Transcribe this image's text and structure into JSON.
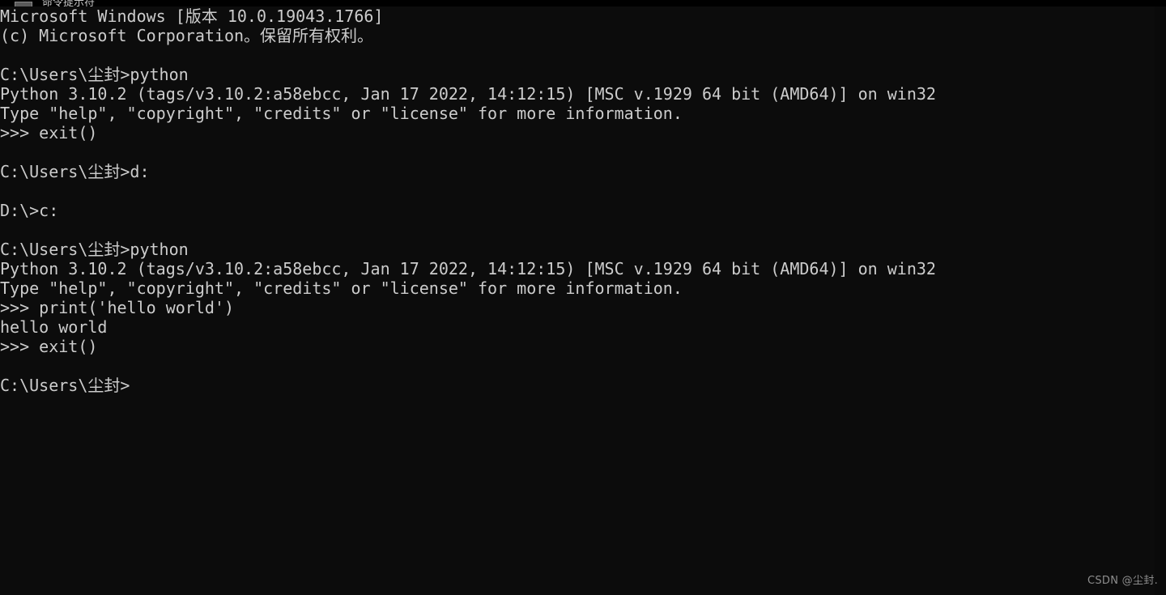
{
  "window": {
    "title": "命令提示符",
    "icon": "console-icon",
    "background_color": "#0c0c0c",
    "foreground_color": "#cccccc"
  },
  "terminal": {
    "lines": [
      "Microsoft Windows [版本 10.0.19043.1766]",
      "(c) Microsoft Corporation。保留所有权利。",
      "",
      "C:\\Users\\尘封>python",
      "Python 3.10.2 (tags/v3.10.2:a58ebcc, Jan 17 2022, 14:12:15) [MSC v.1929 64 bit (AMD64)] on win32",
      "Type \"help\", \"copyright\", \"credits\" or \"license\" for more information.",
      ">>> exit()",
      "",
      "C:\\Users\\尘封>d:",
      "",
      "D:\\>c:",
      "",
      "C:\\Users\\尘封>python",
      "Python 3.10.2 (tags/v3.10.2:a58ebcc, Jan 17 2022, 14:12:15) [MSC v.1929 64 bit (AMD64)] on win32",
      "Type \"help\", \"copyright\", \"credits\" or \"license\" for more information.",
      ">>> print('hello world')",
      "hello world",
      ">>> exit()",
      "",
      "C:\\Users\\尘封>"
    ]
  },
  "watermark": {
    "text": "CSDN @尘封."
  }
}
